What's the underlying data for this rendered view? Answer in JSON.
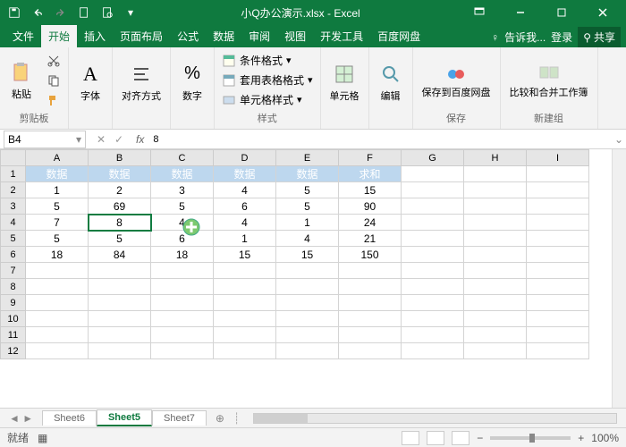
{
  "title": "小Q办公演示.xlsx - Excel",
  "tabs": [
    "文件",
    "开始",
    "插入",
    "页面布局",
    "公式",
    "数据",
    "审阅",
    "视图",
    "开发工具",
    "百度网盘"
  ],
  "active_tab": 1,
  "tell_me": "告诉我...",
  "signin": "登录",
  "share": "共享",
  "ribbon": {
    "clipboard": {
      "paste": "粘贴",
      "label": "剪贴板"
    },
    "font": {
      "btn": "字体",
      "label": ""
    },
    "align": {
      "btn": "对齐方式",
      "label": ""
    },
    "number": {
      "btn": "数字",
      "label": ""
    },
    "styles": {
      "cond": "条件格式",
      "table": "套用表格格式",
      "cell": "单元格样式",
      "label": "样式"
    },
    "cells": {
      "btn": "单元格",
      "label": ""
    },
    "edit": {
      "btn": "编辑",
      "label": ""
    },
    "baidu": {
      "btn": "保存到百度网盘",
      "label": "保存"
    },
    "newgrp": {
      "btn": "比较和合并工作簿",
      "label": "新建组"
    }
  },
  "namebox": "B4",
  "formula_value": "8",
  "columns": [
    "A",
    "B",
    "C",
    "D",
    "E",
    "F",
    "G",
    "H",
    "I"
  ],
  "rows": [
    1,
    2,
    3,
    4,
    5,
    6,
    7,
    8,
    9,
    10,
    11,
    12
  ],
  "header_row": [
    "数据",
    "数据",
    "数据",
    "数据",
    "数据",
    "求和"
  ],
  "chart_data": {
    "type": "table",
    "title": "",
    "rows": [
      [
        "1",
        "2",
        "3",
        "4",
        "5",
        "15"
      ],
      [
        "5",
        "69",
        "5",
        "6",
        "5",
        "90"
      ],
      [
        "7",
        "8",
        "4",
        "4",
        "1",
        "24"
      ],
      [
        "5",
        "5",
        "6",
        "1",
        "4",
        "21"
      ],
      [
        "18",
        "84",
        "18",
        "15",
        "15",
        "150"
      ]
    ]
  },
  "selected_cell": {
    "row": 4,
    "col": 2
  },
  "sheet_tabs": [
    "Sheet6",
    "Sheet5",
    "Sheet7"
  ],
  "active_sheet": 1,
  "status_text": "就绪",
  "zoom": "100%"
}
